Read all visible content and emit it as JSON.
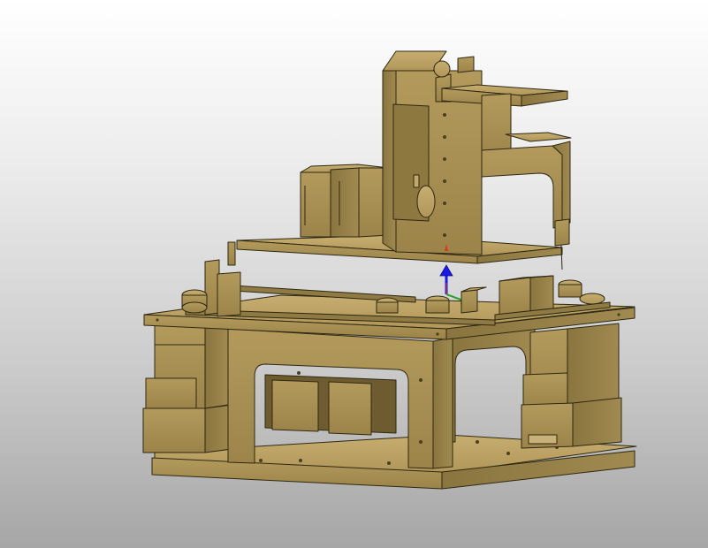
{
  "viewport": {
    "background_top": "#ffffff",
    "background_bottom": "#a6a6a6"
  },
  "model": {
    "body_color": "#a88e52",
    "highlight_color": "#c2a96a",
    "shadow_color": "#7e6a3a",
    "edge_color": "#2e2812"
  },
  "triad": {
    "z_axis_color": "#1a1ae6",
    "x_axis_color": "#d23a1e",
    "y_axis_color": "#2aa02a",
    "z_axis_icon": "arrow-up-icon"
  }
}
